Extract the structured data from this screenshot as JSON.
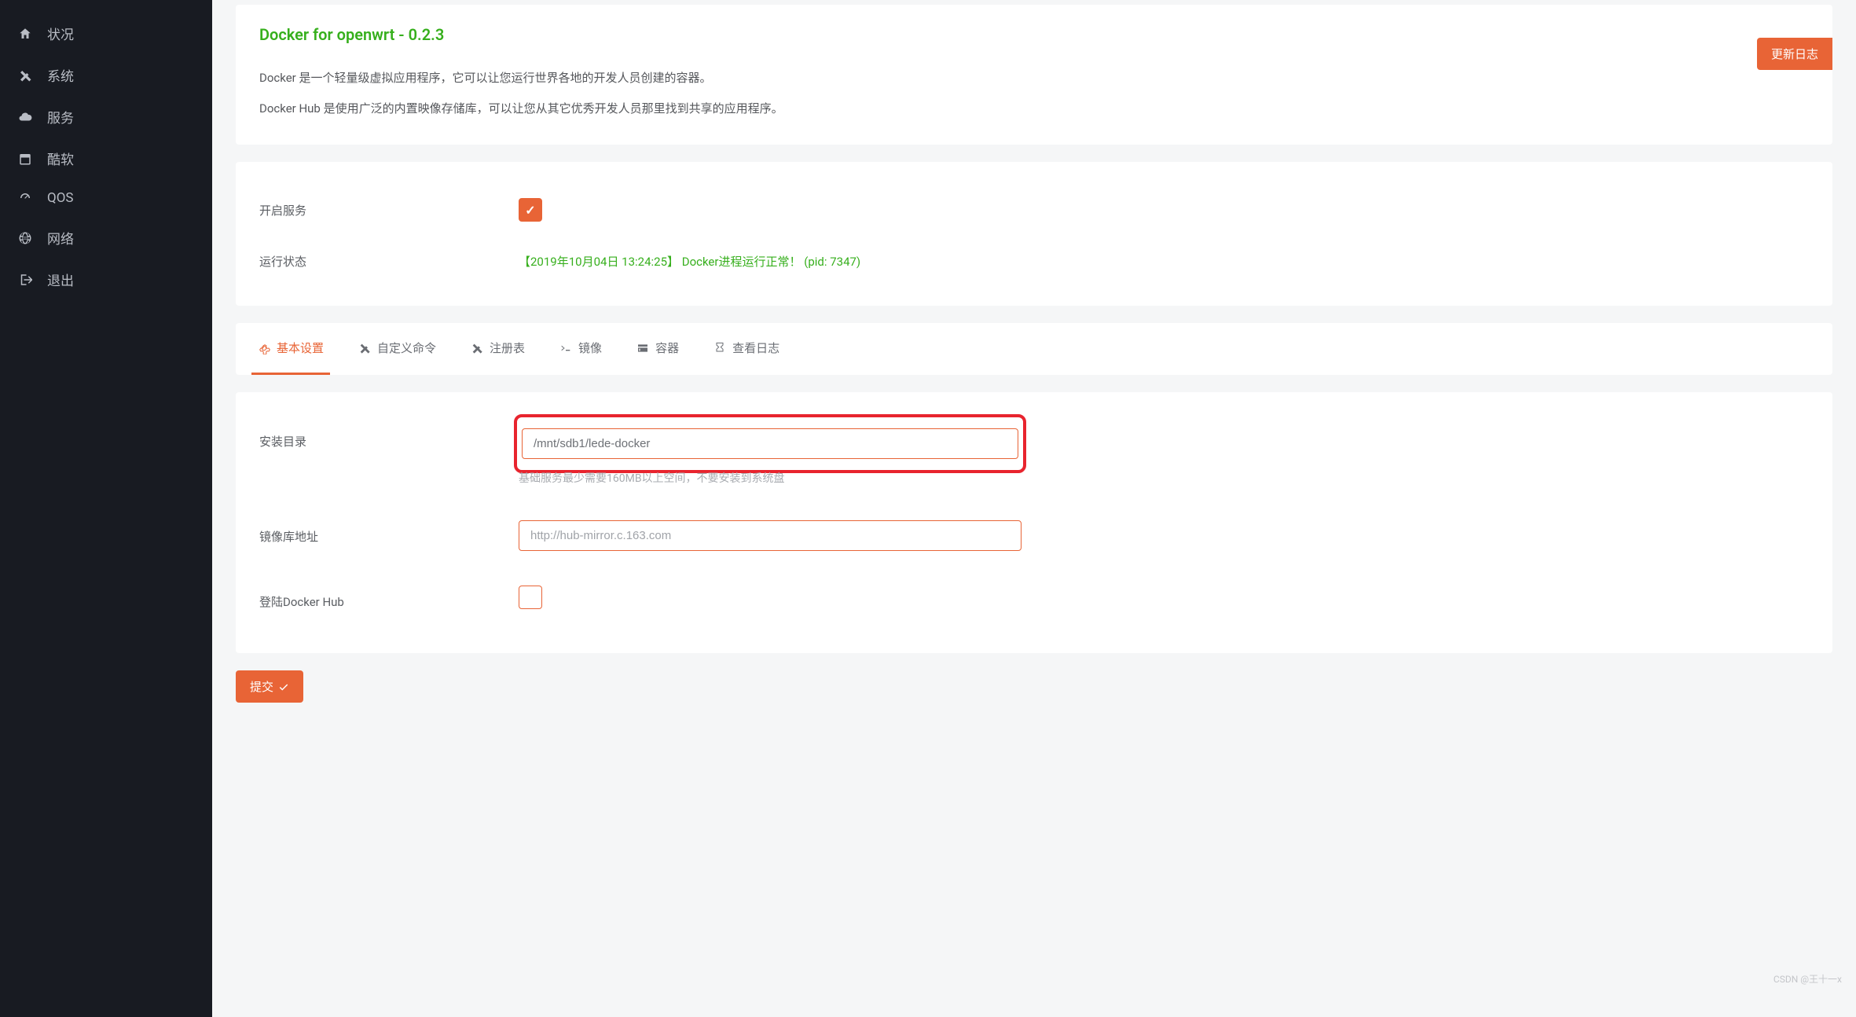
{
  "sidebar": {
    "items": [
      {
        "label": "状况"
      },
      {
        "label": "系统"
      },
      {
        "label": "服务"
      },
      {
        "label": "酷软"
      },
      {
        "label": "QOS"
      },
      {
        "label": "网络"
      },
      {
        "label": "退出"
      }
    ]
  },
  "header": {
    "title": "Docker for openwrt - 0.2.3",
    "desc1": "Docker 是一个轻量级虚拟应用程序，它可以让您运行世界各地的开发人员创建的容器。",
    "desc2": "Docker Hub 是使用广泛的内置映像存储库，可以让您从其它优秀开发人员那里找到共享的应用程序。",
    "update_button": "更新日志"
  },
  "status": {
    "enable_label": "开启服务",
    "runtime_label": "运行状态",
    "runtime_text": "【2019年10月04日 13:24:25】   Docker进程运行正常！   (pid: 7347)"
  },
  "tabs": [
    {
      "label": "基本设置"
    },
    {
      "label": "自定义命令"
    },
    {
      "label": "注册表"
    },
    {
      "label": "镜像"
    },
    {
      "label": "容器"
    },
    {
      "label": "查看日志"
    }
  ],
  "settings": {
    "install_dir_label": "安装目录",
    "install_dir_value": "/mnt/sdb1/lede-docker",
    "install_dir_hint": "基础服务最少需要160MB以上空间，不要安装到系统盘",
    "mirror_label": "镜像库地址",
    "mirror_placeholder": "http://hub-mirror.c.163.com",
    "login_label": "登陆Docker Hub"
  },
  "submit_button": "提交",
  "watermark": "CSDN @王十一x"
}
